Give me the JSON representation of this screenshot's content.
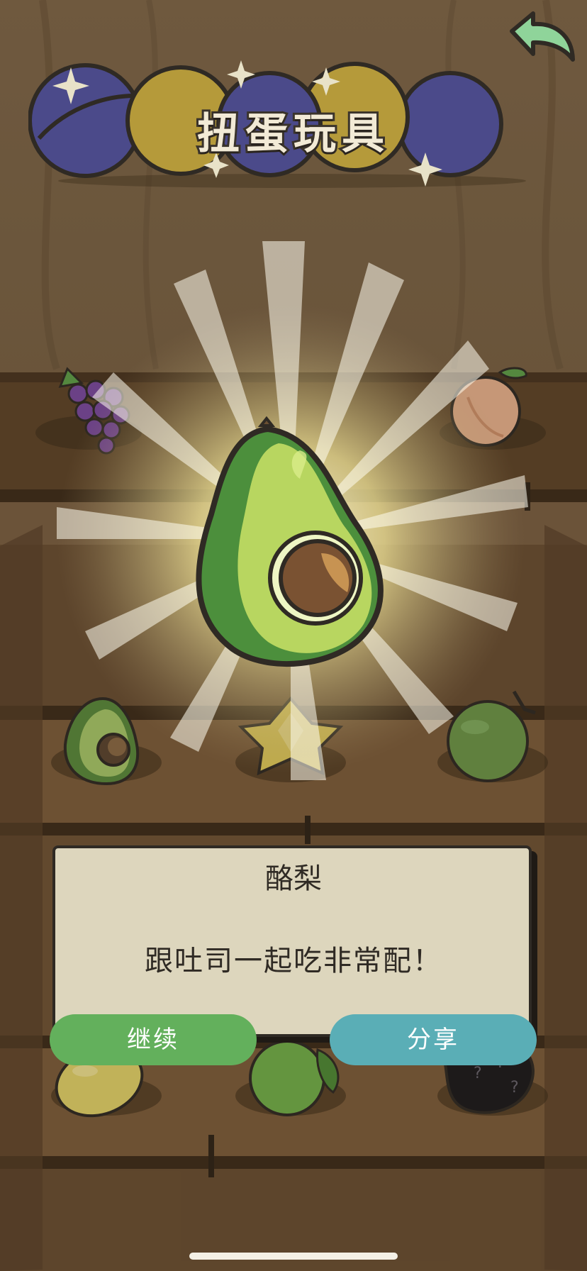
{
  "header": {
    "title": "扭蛋玩具"
  },
  "result": {
    "name": "酪梨",
    "description": "跟吐司一起吃非常配！"
  },
  "buttons": {
    "continue_label": "继续",
    "share_label": "分享"
  },
  "shelf_items": [
    "grape-icon",
    "peach-icon",
    "avocado-icon",
    "starfruit-icon",
    "coconut-icon",
    "lemon-icon",
    "lime-icon",
    "locked-mystery-icon"
  ],
  "colors": {
    "continue_button": "#63b05c",
    "share_button": "#5aaeb6",
    "card_background": "#ddd6bd",
    "wood": "#6b5134"
  }
}
